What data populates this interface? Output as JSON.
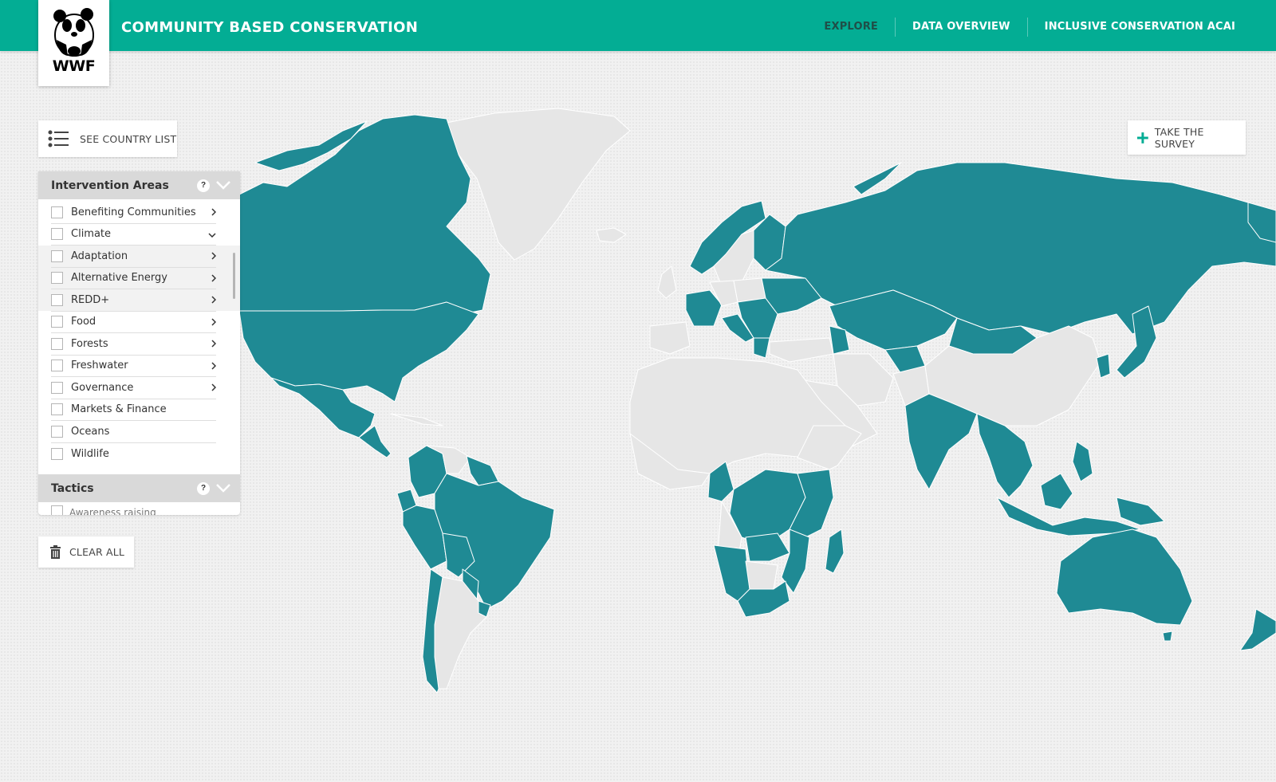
{
  "header": {
    "logo_text": "WWF",
    "site_title": "COMMUNITY BASED CONSERVATION",
    "nav": [
      {
        "label": "EXPLORE",
        "active": true
      },
      {
        "label": "DATA OVERVIEW",
        "active": false
      },
      {
        "label": "INCLUSIVE CONSERVATION ACAI",
        "active": false
      }
    ]
  },
  "toolbar": {
    "country_list_label": "SEE COUNTRY LIST",
    "survey_label": "TAKE THE SURVEY",
    "clear_label": "CLEAR ALL"
  },
  "filters": {
    "intervention_title": "Intervention Areas",
    "help_label": "?",
    "items": [
      {
        "label": "Benefiting Communities",
        "checked": false,
        "expandable": true
      },
      {
        "label": "Climate",
        "checked": false,
        "expanded": true
      },
      {
        "label": "Adaptation",
        "checked": false,
        "expandable": true,
        "sub": true
      },
      {
        "label": "Alternative Energy",
        "checked": false,
        "expandable": true,
        "sub": true
      },
      {
        "label": "REDD+",
        "checked": false,
        "expandable": true,
        "sub": true
      },
      {
        "label": "Food",
        "checked": false,
        "expandable": true
      },
      {
        "label": "Forests",
        "checked": false,
        "expandable": true
      },
      {
        "label": "Freshwater",
        "checked": false,
        "expandable": true
      },
      {
        "label": "Governance",
        "checked": false,
        "expandable": true
      },
      {
        "label": "Markets & Finance",
        "checked": false,
        "expandable": false
      },
      {
        "label": "Oceans",
        "checked": false,
        "expandable": false
      },
      {
        "label": "Wildlife",
        "checked": false,
        "expandable": false
      }
    ],
    "tactics_title": "Tactics",
    "tactics_first_item": "Awareness raising"
  },
  "map": {
    "highlight_color": "#1f8a94",
    "base_color": "#e6e6e6",
    "border_color": "#ffffff"
  },
  "colors": {
    "header": "#03ad94",
    "active_nav": "#1f4f48"
  }
}
